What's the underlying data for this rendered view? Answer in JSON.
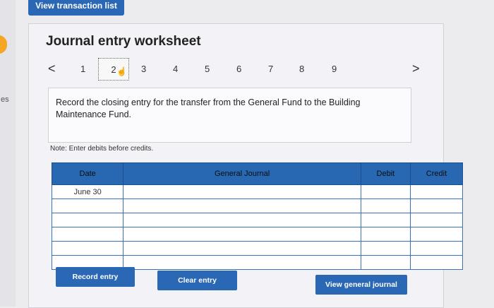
{
  "top_button": "View transaction list",
  "side_text": "es",
  "title": "Journal entry worksheet",
  "pager": {
    "prev": "<",
    "next": ">",
    "pages": [
      "1",
      "2",
      "3",
      "4",
      "5",
      "6",
      "7",
      "8",
      "9"
    ],
    "current": "2"
  },
  "instruction": "Record the closing entry for the transfer from the General Fund to the Building Maintenance Fund.",
  "note": "Note: Enter debits before credits.",
  "table": {
    "headers": {
      "date": "Date",
      "general_journal": "General Journal",
      "debit": "Debit",
      "credit": "Credit"
    },
    "rows": [
      {
        "date": "June 30",
        "account": "",
        "debit": "",
        "credit": ""
      },
      {
        "date": "",
        "account": "",
        "debit": "",
        "credit": ""
      },
      {
        "date": "",
        "account": "",
        "debit": "",
        "credit": ""
      },
      {
        "date": "",
        "account": "",
        "debit": "",
        "credit": ""
      },
      {
        "date": "",
        "account": "",
        "debit": "",
        "credit": ""
      },
      {
        "date": "",
        "account": "",
        "debit": "",
        "credit": ""
      }
    ]
  },
  "buttons": {
    "record": "Record entry",
    "clear": "Clear entry",
    "view": "View general journal"
  }
}
